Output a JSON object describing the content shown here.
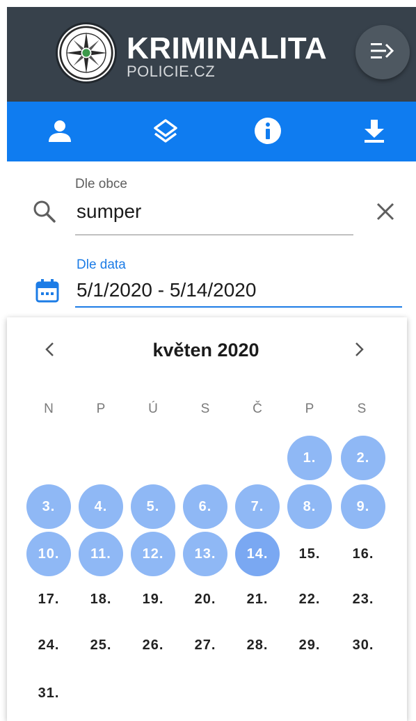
{
  "header": {
    "title": "KRIMINALITA",
    "subtitle": "POLICIE.CZ",
    "logo_icon": "police-badge-icon",
    "menu_icon": "collapse-menu-icon"
  },
  "toolbar": {
    "items": [
      {
        "icon": "person-icon"
      },
      {
        "icon": "layers-icon"
      },
      {
        "icon": "info-icon"
      },
      {
        "icon": "download-icon"
      }
    ]
  },
  "search": {
    "label": "Dle obce",
    "value": "sumper",
    "icon": "search-icon",
    "clear_icon": "close-icon"
  },
  "date_filter": {
    "label": "Dle data",
    "value": "5/1/2020 - 5/14/2020",
    "icon": "calendar-icon"
  },
  "calendar": {
    "month_label": "květen 2020",
    "weekdays": [
      "N",
      "P",
      "Ú",
      "S",
      "Č",
      "P",
      "S"
    ],
    "first_weekday_index": 5,
    "days_in_month": 31,
    "range_start": 1,
    "range_end": 14,
    "days": [
      "1.",
      "2.",
      "3.",
      "4.",
      "5.",
      "6.",
      "7.",
      "8.",
      "9.",
      "10.",
      "11.",
      "12.",
      "13.",
      "14.",
      "15.",
      "16.",
      "17.",
      "18.",
      "19.",
      "20.",
      "21.",
      "22.",
      "23.",
      "24.",
      "25.",
      "26.",
      "27.",
      "28.",
      "29.",
      "30.",
      "31."
    ]
  },
  "colors": {
    "header_bg": "#37414b",
    "toolbar_bg": "#0f7cf0",
    "accent": "#1c7ce6",
    "range_bg": "#8fb8f5"
  }
}
